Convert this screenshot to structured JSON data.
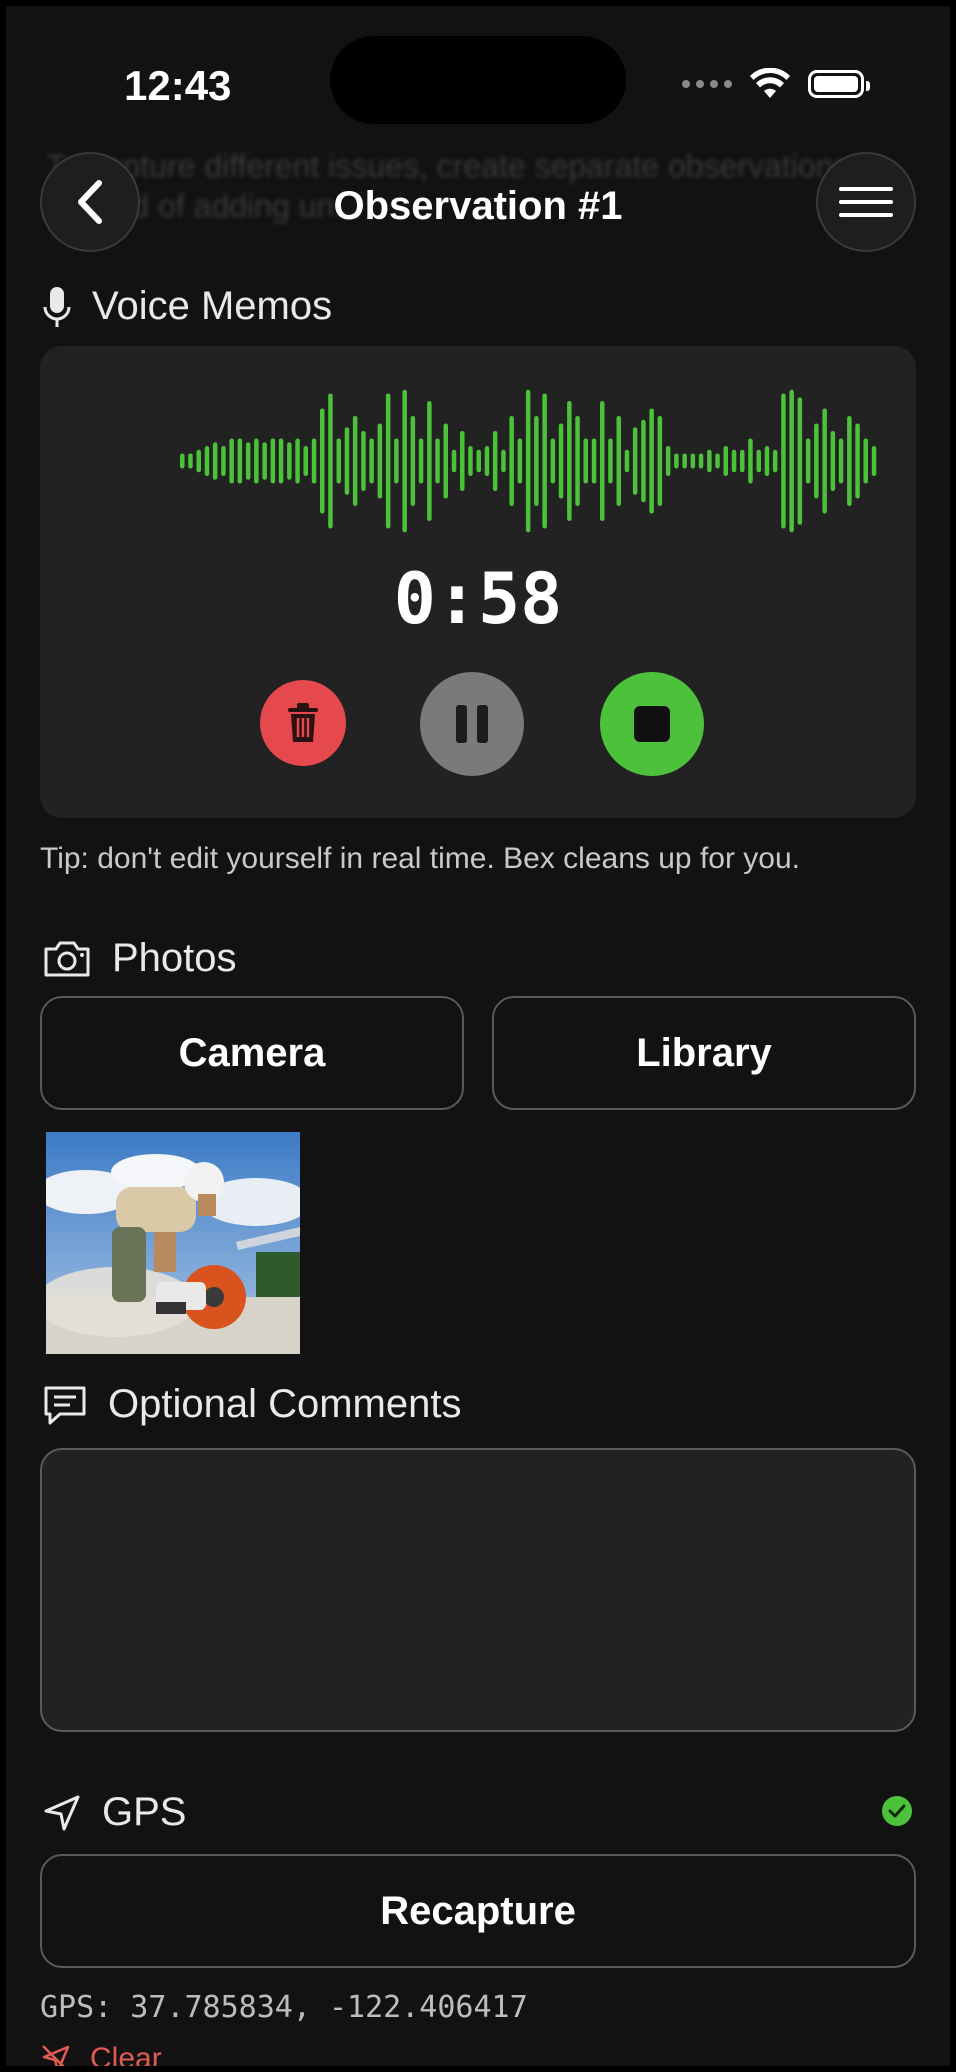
{
  "status_bar": {
    "time": "12:43"
  },
  "nav": {
    "title": "Observation #1",
    "ghost_text": "To capture different issues, create separate observations instead of adding un..."
  },
  "voice_memos": {
    "heading": "Voice Memos",
    "timer": "0:58",
    "recording_level": [
      0.1,
      0.1,
      0.15,
      0.2,
      0.25,
      0.2,
      0.3,
      0.3,
      0.25,
      0.3,
      0.25,
      0.3,
      0.3,
      0.25,
      0.3,
      0.2,
      0.3,
      0.7,
      0.9,
      0.3,
      0.45,
      0.6,
      0.4,
      0.3,
      0.5,
      0.9,
      0.3,
      0.95,
      0.6,
      0.3,
      0.8,
      0.3,
      0.5,
      0.15,
      0.4,
      0.2,
      0.15,
      0.2,
      0.4,
      0.15,
      0.6,
      0.3,
      0.95,
      0.6,
      0.9,
      0.3,
      0.5,
      0.8,
      0.6,
      0.3,
      0.3,
      0.8,
      0.3,
      0.6,
      0.15,
      0.45,
      0.55,
      0.7,
      0.6,
      0.2,
      0.1,
      0.1,
      0.1,
      0.1,
      0.15,
      0.1,
      0.2,
      0.15,
      0.15,
      0.3,
      0.15,
      0.2,
      0.15,
      0.9,
      0.95,
      0.85,
      0.3,
      0.5,
      0.7,
      0.4,
      0.3,
      0.6,
      0.5,
      0.3,
      0.2
    ],
    "wave_color": "#4cc23a",
    "tip": "Tip: don't edit yourself in real time. Bex cleans up for you."
  },
  "photos": {
    "heading": "Photos",
    "camera_label": "Camera",
    "library_label": "Library"
  },
  "comments": {
    "heading": "Optional Comments"
  },
  "gps": {
    "heading": "GPS",
    "recapture_label": "Recapture",
    "coords": "GPS: 37.785834, -122.406417",
    "clear_label": "Clear"
  },
  "colors": {
    "accent_green": "#4cc23a",
    "delete_red": "#e5484d",
    "clear_red": "#e05a52"
  }
}
